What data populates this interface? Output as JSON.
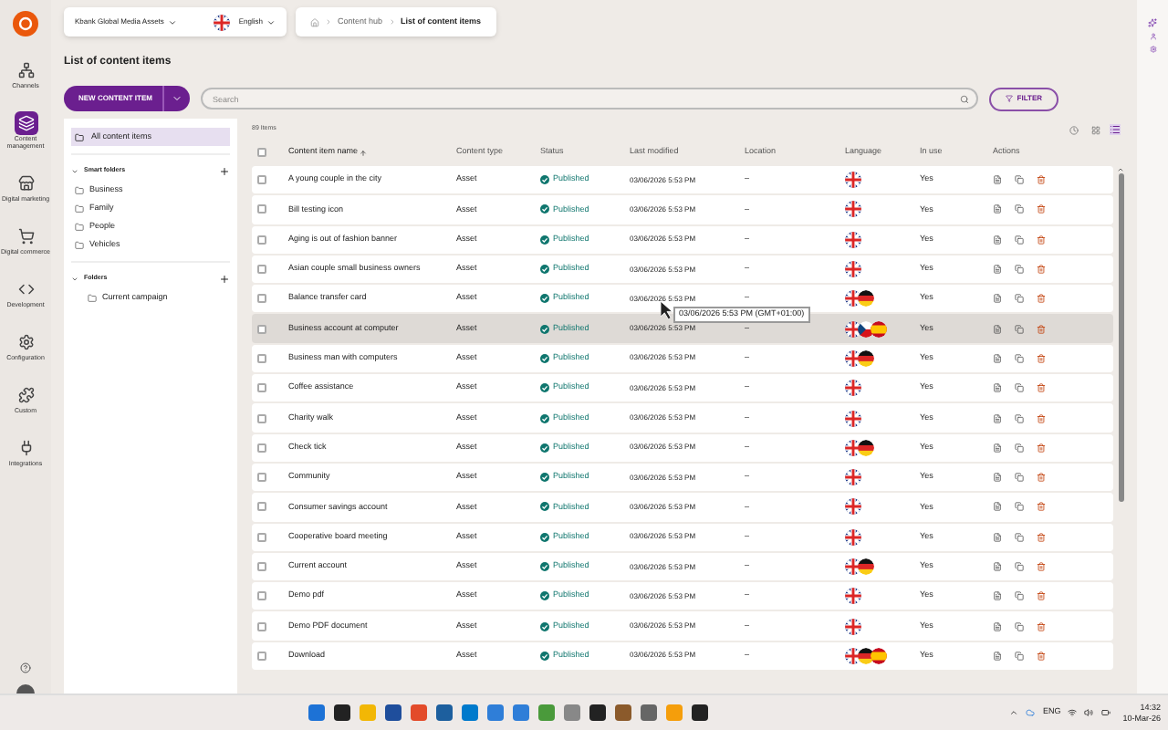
{
  "top_bar": {
    "site": "Kbank Global Media Assets",
    "language": "English",
    "breadcrumb": [
      "Content hub",
      "List of content items"
    ]
  },
  "nav": [
    {
      "label": "Channels",
      "selected": false
    },
    {
      "label": "Content management",
      "selected": true
    },
    {
      "label": "Digital marketing",
      "selected": false
    },
    {
      "label": "Digital commerce",
      "selected": false
    },
    {
      "label": "Development",
      "selected": false
    },
    {
      "label": "Configuration",
      "selected": false
    },
    {
      "label": "Custom",
      "selected": false
    },
    {
      "label": "Integrations",
      "selected": false
    }
  ],
  "page_title": "List of content items",
  "new_button": "NEW CONTENT ITEM",
  "search": {
    "placeholder": "Search"
  },
  "filter_button": "FILTER",
  "sidebar": {
    "all_items": {
      "label": "All content items",
      "selected": true
    },
    "smart_folders": {
      "label": "Smart folders",
      "expanded": true,
      "items": [
        "Business",
        "Family",
        "People",
        "Vehicles"
      ]
    },
    "folders": {
      "label": "Folders",
      "expanded": true,
      "items": [
        "Current campaign"
      ]
    }
  },
  "item_count": "89 Items",
  "table": {
    "select_all_checked": false,
    "columns": [
      "Content item name",
      "Content type",
      "Status",
      "Last modified",
      "Location",
      "Language",
      "In use",
      "Actions"
    ],
    "rows": [
      {
        "name": "A young couple in the city",
        "type": "Asset",
        "status": "Published",
        "modified": "03/06/2026 5:53 PM",
        "location": "–",
        "languages": [
          {
            "kind": "gb"
          }
        ],
        "in_use": "Yes",
        "selected": false
      },
      {
        "name": "Bill testing icon",
        "type": "Asset",
        "status": "Published",
        "modified": "03/06/2026 5:53 PM",
        "location": "–",
        "languages": [
          {
            "kind": "gb"
          }
        ],
        "in_use": "Yes",
        "selected": false
      },
      {
        "name": "Aging is out of fashion banner",
        "type": "Asset",
        "status": "Published",
        "modified": "03/06/2026 5:53 PM",
        "location": "–",
        "languages": [
          {
            "kind": "gb"
          }
        ],
        "in_use": "Yes",
        "selected": false
      },
      {
        "name": "Asian couple small business owners",
        "type": "Asset",
        "status": "Published",
        "modified": "03/06/2026 5:53 PM",
        "location": "–",
        "languages": [
          {
            "kind": "gb"
          }
        ],
        "in_use": "Yes",
        "selected": false
      },
      {
        "name": "Balance transfer card",
        "type": "Asset",
        "status": "Published",
        "modified": "03/06/2026 5:53 PM",
        "location": "–",
        "languages": [
          {
            "kind": "gb"
          },
          {
            "kind": "de"
          }
        ],
        "in_use": "Yes",
        "selected": false
      },
      {
        "name": "Business account at computer",
        "type": "Asset",
        "status": "Published",
        "modified": "03/06/2026 5:53 PM",
        "location": "–",
        "languages": [
          {
            "kind": "gb"
          },
          {
            "kind": "cz"
          },
          {
            "kind": "es"
          }
        ],
        "in_use": "Yes",
        "selected": true
      },
      {
        "name": "Business man with computers",
        "type": "Asset",
        "status": "Published",
        "modified": "03/06/2026 5:53 PM",
        "location": "–",
        "languages": [
          {
            "kind": "gb"
          },
          {
            "kind": "de"
          }
        ],
        "in_use": "Yes",
        "selected": false
      },
      {
        "name": "Coffee assistance",
        "type": "Asset",
        "status": "Published",
        "modified": "03/06/2026 5:53 PM",
        "location": "–",
        "languages": [
          {
            "kind": "gb"
          }
        ],
        "in_use": "Yes",
        "selected": false
      },
      {
        "name": "Charity walk",
        "type": "Asset",
        "status": "Published",
        "modified": "03/06/2026 5:53 PM",
        "location": "–",
        "languages": [
          {
            "kind": "gb"
          }
        ],
        "in_use": "Yes",
        "selected": false
      },
      {
        "name": "Check tick",
        "type": "Asset",
        "status": "Published",
        "modified": "03/06/2026 5:53 PM",
        "location": "–",
        "languages": [
          {
            "kind": "gb"
          },
          {
            "kind": "de"
          }
        ],
        "in_use": "Yes",
        "selected": false
      },
      {
        "name": "Community",
        "type": "Asset",
        "status": "Published",
        "modified": "03/06/2026 5:53 PM",
        "location": "–",
        "languages": [
          {
            "kind": "gb"
          }
        ],
        "in_use": "Yes",
        "selected": false
      },
      {
        "name": "Consumer savings account",
        "type": "Asset",
        "status": "Published",
        "modified": "03/06/2026 5:53 PM",
        "location": "–",
        "languages": [
          {
            "kind": "gb"
          }
        ],
        "in_use": "Yes",
        "selected": false
      },
      {
        "name": "Cooperative board meeting",
        "type": "Asset",
        "status": "Published",
        "modified": "03/06/2026 5:53 PM",
        "location": "–",
        "languages": [
          {
            "kind": "gb"
          }
        ],
        "in_use": "Yes",
        "selected": false
      },
      {
        "name": "Current account",
        "type": "Asset",
        "status": "Published",
        "modified": "03/06/2026 5:53 PM",
        "location": "–",
        "languages": [
          {
            "kind": "gb"
          },
          {
            "kind": "de"
          }
        ],
        "in_use": "Yes",
        "selected": false
      },
      {
        "name": "Demo pdf",
        "type": "Asset",
        "status": "Published",
        "modified": "03/06/2026 5:53 PM",
        "location": "–",
        "languages": [
          {
            "kind": "gb"
          }
        ],
        "in_use": "Yes",
        "selected": false
      },
      {
        "name": "Demo PDF document",
        "type": "Asset",
        "status": "Published",
        "modified": "03/06/2026 5:53 PM",
        "location": "–",
        "languages": [
          {
            "kind": "gb"
          }
        ],
        "in_use": "Yes",
        "selected": false
      },
      {
        "name": "Download",
        "type": "Asset",
        "status": "Published",
        "modified": "03/06/2026 5:53 PM",
        "location": "–",
        "languages": [
          {
            "kind": "gb"
          },
          {
            "kind": "de"
          },
          {
            "kind": "es"
          }
        ],
        "in_use": "Yes",
        "selected": false
      }
    ]
  },
  "tooltip": "03/06/2026 5:53 PM (GMT+01:00)",
  "taskbar": {
    "language": "ENG",
    "time": "14:32",
    "date": "10-Mar-26"
  }
}
